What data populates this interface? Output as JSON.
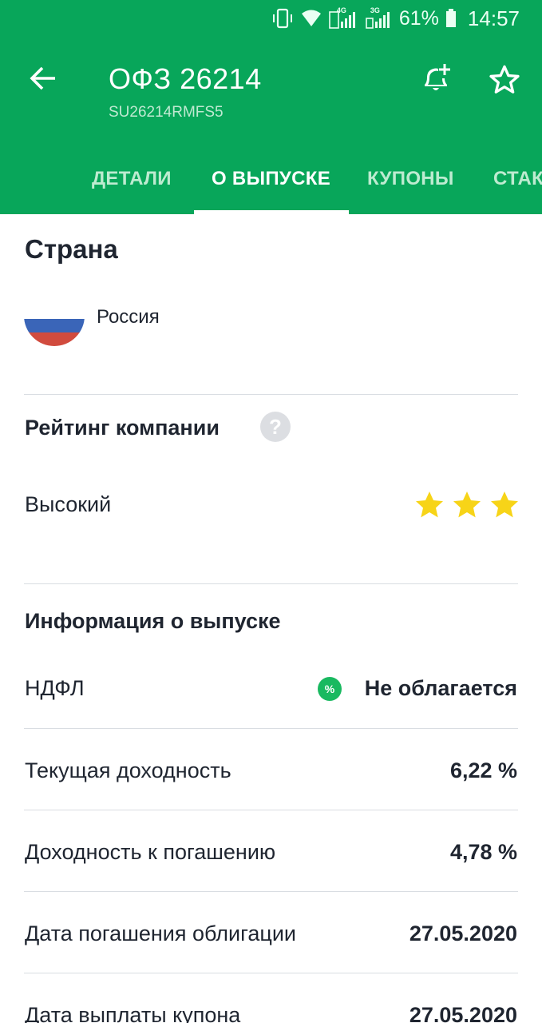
{
  "status_bar": {
    "battery": "61%",
    "time": "14:57",
    "network_labels": [
      "4G",
      "3G"
    ]
  },
  "header": {
    "title": "ОФЗ 26214",
    "isin": "SU26214RMFS5"
  },
  "tabs": [
    {
      "label": "ДЕТАЛИ",
      "active": false
    },
    {
      "label": "О ВЫПУСКЕ",
      "active": true
    },
    {
      "label": "КУПОНЫ",
      "active": false
    },
    {
      "label": "СТАКАН",
      "active": false
    }
  ],
  "country": {
    "heading": "Страна",
    "name": "Россия"
  },
  "rating": {
    "heading": "Рейтинг компании",
    "value": "Высокий",
    "stars": 3,
    "star_color": "#f7d418"
  },
  "issue_info": {
    "heading": "Информация о выпуске",
    "rows": [
      {
        "label": "НДФЛ",
        "value": "Не облагается"
      },
      {
        "label": "Текущая доходность",
        "value": "6,22 %"
      },
      {
        "label": "Доходность к погашению",
        "value": "4,78 %"
      },
      {
        "label": "Дата погашения облигации",
        "value": "27.05.2020"
      },
      {
        "label": "Дата выплаты купона",
        "value": "27.05.2020"
      }
    ]
  },
  "colors": {
    "brand_green": "#08a65a",
    "text_dark": "#1f2530",
    "badge_green": "#19b960"
  }
}
